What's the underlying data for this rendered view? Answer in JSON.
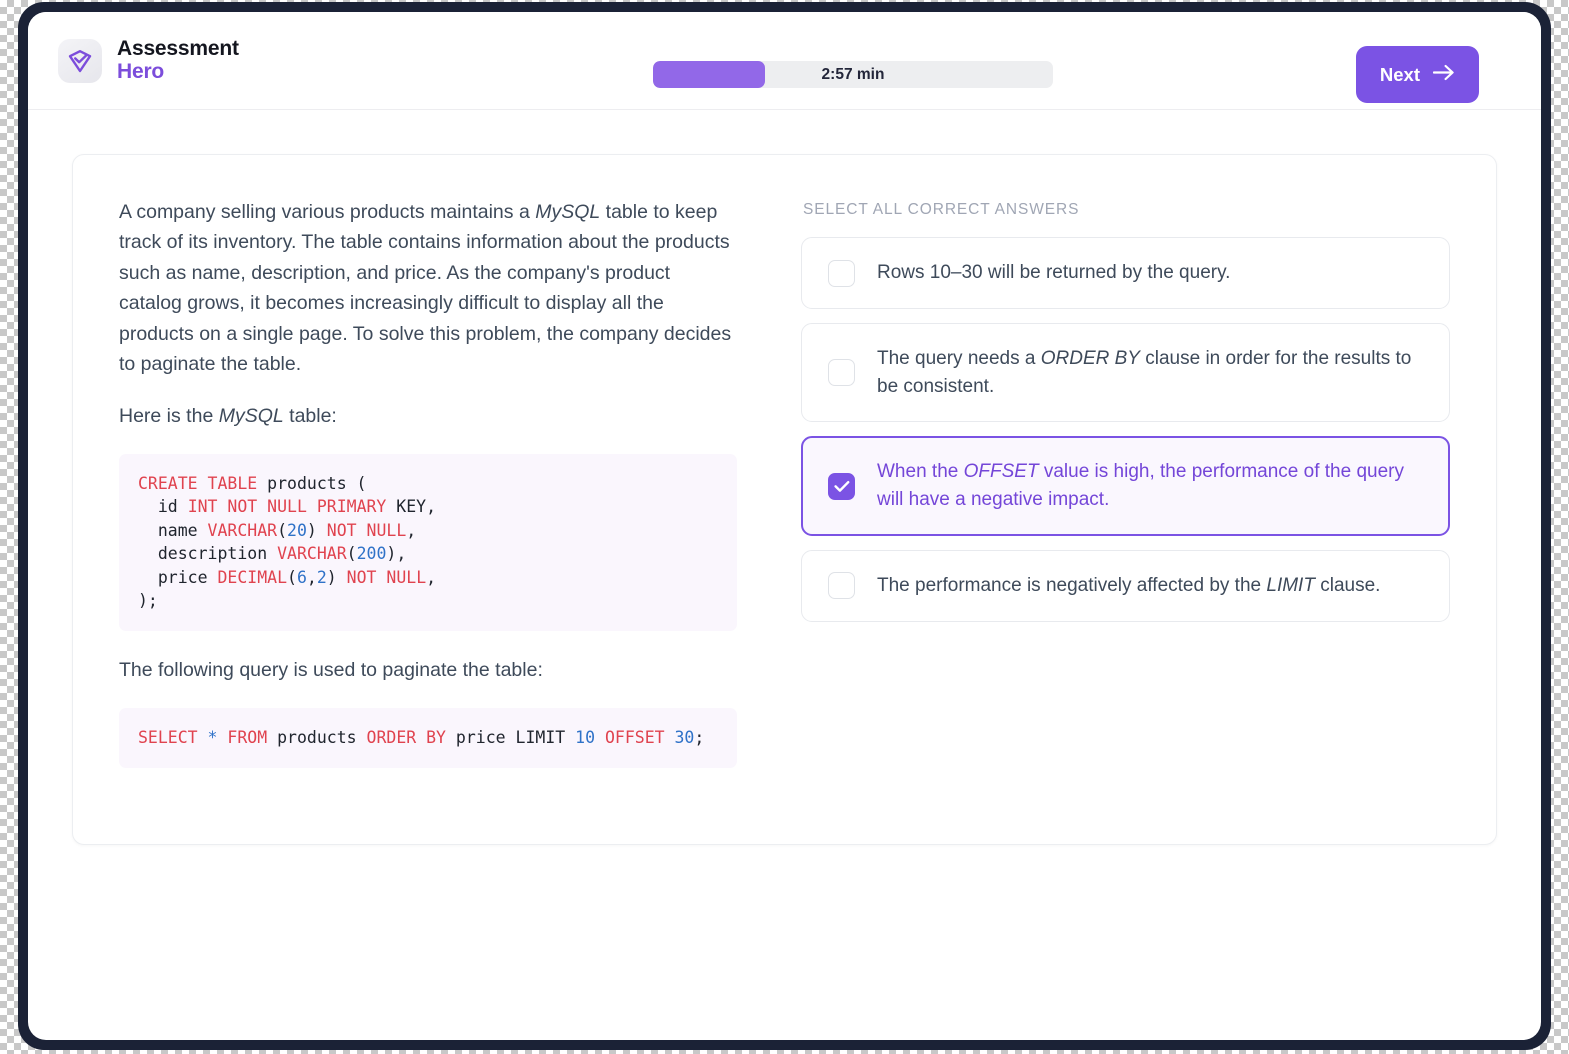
{
  "brand": {
    "line1": "Assessment",
    "line2": "Hero",
    "logo_icon": "shield-check-icon",
    "accent_color": "#7c4ddb"
  },
  "header": {
    "timer": {
      "label": "2:57 min",
      "progress_percent": 28,
      "fill_color": "#9268e8",
      "track_color": "#edeef0"
    },
    "next_button": {
      "label": "Next",
      "icon": "arrow-right-icon",
      "color": "#7b53e4"
    }
  },
  "question": {
    "paragraphs": [
      {
        "id": "p1",
        "segments": [
          {
            "text": "A company selling various products maintains a "
          },
          {
            "text": "MySQL",
            "italic": true
          },
          {
            "text": " table to keep track of its inventory. The table contains information about the products such as name, description, and price. As the company's product catalog grows, it becomes increasingly difficult to display all the products on a single page. To solve this problem, the company decides to paginate the table."
          }
        ]
      },
      {
        "id": "p2",
        "segments": [
          {
            "text": "Here is the "
          },
          {
            "text": "MySQL",
            "italic": true
          },
          {
            "text": " table:"
          }
        ]
      }
    ],
    "paragraph_after_first_code": {
      "segments": [
        {
          "text": "The following query is used to paginate the table:"
        }
      ]
    },
    "code_blocks": [
      {
        "id": "create-table",
        "language": "sql",
        "plain_text": "CREATE TABLE products (\n  id INT NOT NULL PRIMARY KEY,\n  name VARCHAR(20) NOT NULL,\n  description VARCHAR(200),\n  price DECIMAL(6,2) NOT NULL,\n);",
        "tokens": [
          {
            "t": "CREATE TABLE",
            "c": "kw"
          },
          {
            "t": " products (\n  id ",
            "c": "id"
          },
          {
            "t": "INT NOT NULL PRIMARY",
            "c": "kw"
          },
          {
            "t": " KEY,\n  name ",
            "c": "id"
          },
          {
            "t": "VARCHAR",
            "c": "kw"
          },
          {
            "t": "(",
            "c": "id"
          },
          {
            "t": "20",
            "c": "num"
          },
          {
            "t": ") ",
            "c": "id"
          },
          {
            "t": "NOT NULL",
            "c": "kw"
          },
          {
            "t": ",\n  description ",
            "c": "id"
          },
          {
            "t": "VARCHAR",
            "c": "kw"
          },
          {
            "t": "(",
            "c": "id"
          },
          {
            "t": "200",
            "c": "num"
          },
          {
            "t": "),\n  price ",
            "c": "id"
          },
          {
            "t": "DECIMAL",
            "c": "kw"
          },
          {
            "t": "(",
            "c": "id"
          },
          {
            "t": "6",
            "c": "num"
          },
          {
            "t": ",",
            "c": "id"
          },
          {
            "t": "2",
            "c": "num"
          },
          {
            "t": ") ",
            "c": "id"
          },
          {
            "t": "NOT NULL",
            "c": "kw"
          },
          {
            "t": ",\n);",
            "c": "id"
          }
        ]
      },
      {
        "id": "select-query",
        "language": "sql",
        "plain_text": "SELECT * FROM products ORDER BY price LIMIT 10 OFFSET 30;",
        "tokens": [
          {
            "t": "SELECT",
            "c": "kw"
          },
          {
            "t": " ",
            "c": "id"
          },
          {
            "t": "*",
            "c": "op"
          },
          {
            "t": " ",
            "c": "id"
          },
          {
            "t": "FROM",
            "c": "kw"
          },
          {
            "t": " products ",
            "c": "id"
          },
          {
            "t": "ORDER BY",
            "c": "kw"
          },
          {
            "t": " price LIMIT ",
            "c": "id"
          },
          {
            "t": "10",
            "c": "num"
          },
          {
            "t": " ",
            "c": "id"
          },
          {
            "t": "OFFSET",
            "c": "kw"
          },
          {
            "t": " ",
            "c": "id"
          },
          {
            "t": "30",
            "c": "num"
          },
          {
            "t": ";",
            "c": "id"
          }
        ]
      }
    ]
  },
  "answers": {
    "heading": "SELECT ALL CORRECT ANSWERS",
    "options": [
      {
        "id": "opt-1",
        "selected": false,
        "check_icon": "unchecked-box-icon",
        "segments": [
          {
            "text": "Rows 10–30 will be returned by the query."
          }
        ]
      },
      {
        "id": "opt-2",
        "selected": false,
        "check_icon": "unchecked-box-icon",
        "segments": [
          {
            "text": "The query needs a "
          },
          {
            "text": "ORDER BY",
            "italic": true
          },
          {
            "text": " clause in order for the results to be consistent."
          }
        ]
      },
      {
        "id": "opt-3",
        "selected": true,
        "check_icon": "checked-box-icon",
        "segments": [
          {
            "text": "When the "
          },
          {
            "text": "OFFSET",
            "italic": true
          },
          {
            "text": " value is high, the performance of the query will have a negative impact."
          }
        ]
      },
      {
        "id": "opt-4",
        "selected": false,
        "check_icon": "unchecked-box-icon",
        "segments": [
          {
            "text": "The performance is negatively affected by the "
          },
          {
            "text": "LIMIT",
            "italic": true
          },
          {
            "text": " clause."
          }
        ]
      }
    ]
  }
}
